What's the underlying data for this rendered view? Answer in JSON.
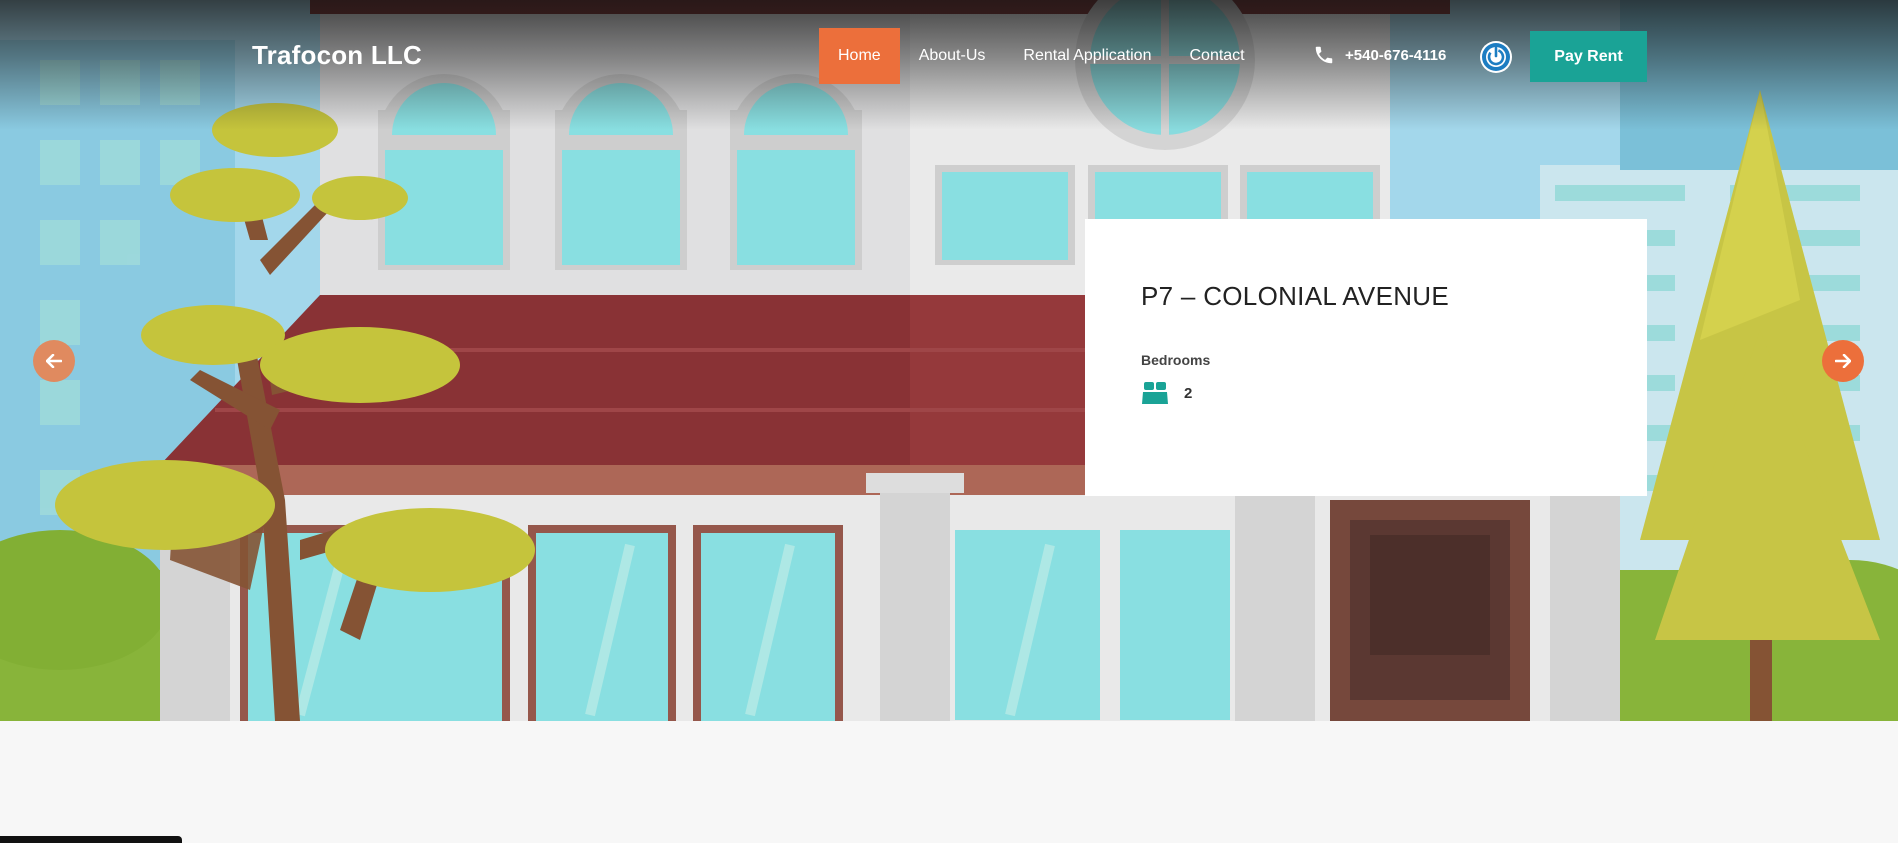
{
  "brand": {
    "name": "Trafocon LLC"
  },
  "nav": {
    "items": [
      {
        "label": "Home",
        "active": true
      },
      {
        "label": "About-Us",
        "active": false
      },
      {
        "label": "Rental Application",
        "active": false
      },
      {
        "label": "Contact",
        "active": false
      }
    ],
    "phone": "+540-676-4116",
    "phone_icon": "phone-icon",
    "power_icon": "power-icon",
    "pay_button": "Pay Rent"
  },
  "slider": {
    "prev_icon": "arrow-left-icon",
    "next_icon": "arrow-right-icon"
  },
  "property": {
    "title": "P7 – COLONIAL AVENUE",
    "bedrooms_label": "Bedrooms",
    "bedrooms_value": "2",
    "bed_icon": "bed-icon"
  },
  "colors": {
    "accent_orange": "#ec6f3b",
    "accent_teal": "#1aa396",
    "power_blue": "#1d7dc2"
  }
}
